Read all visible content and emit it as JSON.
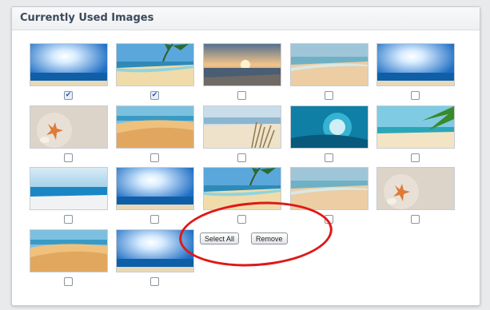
{
  "panel": {
    "title": "Currently Used Images"
  },
  "images": [
    {
      "scene": "sun-sky-sea",
      "checked": true
    },
    {
      "scene": "palm-beach",
      "checked": true
    },
    {
      "scene": "sunset-sea",
      "checked": false
    },
    {
      "scene": "calm-beach",
      "checked": false
    },
    {
      "scene": "sun-sky-sea",
      "checked": false
    },
    {
      "scene": "starfish-sand",
      "checked": false
    },
    {
      "scene": "dunes",
      "checked": false
    },
    {
      "scene": "dune-grass",
      "checked": false
    },
    {
      "scene": "wave-surfer",
      "checked": false
    },
    {
      "scene": "palm-leaves-sea",
      "checked": false
    },
    {
      "scene": "sea-horizon",
      "checked": false
    },
    {
      "scene": "sun-sky-sea",
      "checked": false
    },
    {
      "scene": "palm-beach",
      "checked": false
    },
    {
      "scene": "calm-beach",
      "checked": false
    },
    {
      "scene": "starfish-sand",
      "checked": false
    },
    {
      "scene": "dunes",
      "checked": false
    },
    {
      "scene": "sun-sky-sea",
      "checked": false
    }
  ],
  "buttons": {
    "select_all": "Select All",
    "remove": "Remove"
  },
  "colors": {
    "highlight_circle": "#e01818",
    "checkmark": "#2a55a8"
  }
}
